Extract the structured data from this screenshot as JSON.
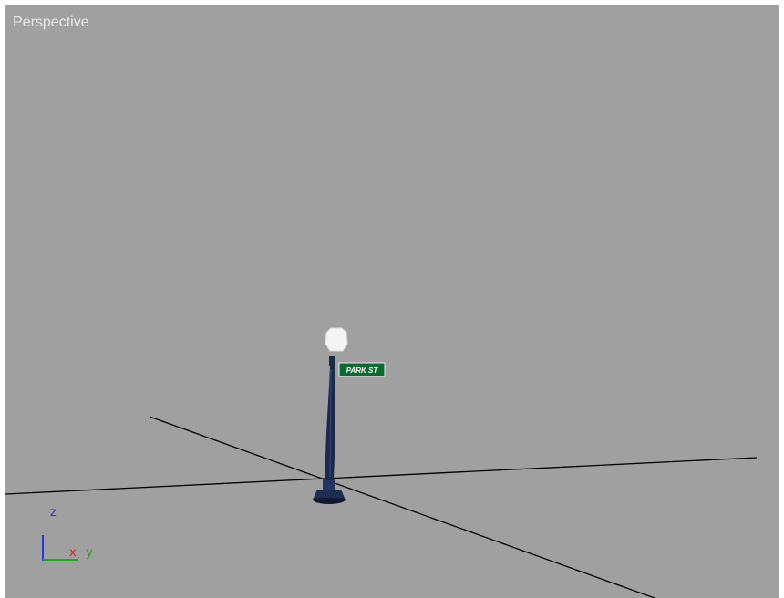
{
  "viewport": {
    "label": "Perspective",
    "background": "#a0a0a0"
  },
  "scene": {
    "object": "street-lamp",
    "street_sign_text": "PARK ST",
    "sign_color": "#0b6b2e",
    "lamp_post_color": "#1b2a4a",
    "lamp_globe_color": "#f4f4f4",
    "grid_line_color": "#000000"
  },
  "axis_tripod": {
    "z_label": "z",
    "x_label": "x",
    "y_label": "y",
    "z_color": "#1f3bd9",
    "x_color": "#d91f1f",
    "y_color": "#1fa81f"
  }
}
